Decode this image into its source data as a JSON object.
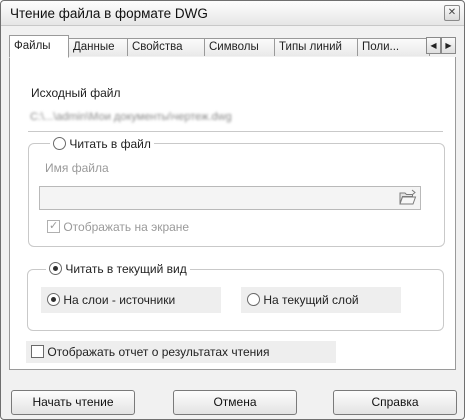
{
  "window": {
    "title": "Чтение файла в формате DWG"
  },
  "tabs": [
    {
      "label": "Файлы",
      "active": true
    },
    {
      "label": "Данные"
    },
    {
      "label": "Свойства"
    },
    {
      "label": "Символы"
    },
    {
      "label": "Типы линий"
    },
    {
      "label": "Поли..."
    }
  ],
  "source": {
    "label": "Исходный файл",
    "path": "C:\\...\\admin\\Мои документы\\чертеж.dwg"
  },
  "read_to_file": {
    "label": "Читать в файл",
    "filename_label": "Имя файла",
    "filename_value": "",
    "show_on_screen_label": "Отображать на экране"
  },
  "read_to_view": {
    "label": "Читать в текущий вид",
    "layers_source_label": "На слои - источники",
    "current_layer_label": "На текущий слой"
  },
  "report": {
    "label": "Отображать отчет о результатах чтения"
  },
  "buttons": {
    "start": "Начать чтение",
    "cancel": "Отмена",
    "help": "Справка"
  },
  "colors": {
    "window_bg": "#f1f1f1",
    "panel_bg": "#ffffff",
    "border": "#9a9a9a",
    "disabled_text": "#9a9a9a"
  }
}
